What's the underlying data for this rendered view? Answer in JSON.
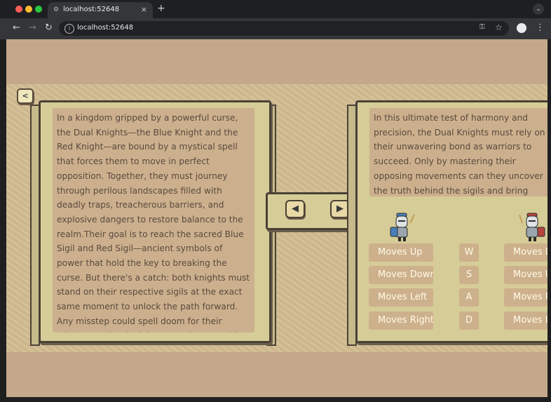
{
  "browser": {
    "tab_title": "localhost:52648",
    "address": "localhost:52648",
    "new_tab": "+",
    "close_tab": "×"
  },
  "game": {
    "back_glyph": "<",
    "prev_glyph": "◀",
    "next_glyph": "▶",
    "left_page_text": "In a kingdom gripped by a powerful curse, the Dual Knights—the Blue Knight and the Red Knight—are bound by a mystical spell that forces them to move in perfect opposition. Together, they must journey through perilous landscapes filled with deadly traps, treacherous barriers, and explosive dangers to restore balance to the realm.Their goal is to reach the sacred Blue Sigil and Red Sigil—ancient symbols of power that hold the key to breaking the curse. But there's a catch: both knights must stand on their respective sigils at the exact same moment to unlock the path forward. Any misstep could spell doom for their mission, and a clash between them would end their journey in a tragic battle.",
    "right_page_text": "In this ultimate test of harmony and precision, the Dual Knights must rely on their unwavering bond as warriors to succeed. Only by mastering their opposing movements can they uncover the truth behind the sigils and bring salvation to the world.",
    "controls": [
      {
        "blue": "Moves Up",
        "key": "W",
        "red": "Moves Down"
      },
      {
        "blue": "Moves Down",
        "key": "S",
        "red": "Moves Up"
      },
      {
        "blue": "Moves Left",
        "key": "A",
        "red": "Moves Right"
      },
      {
        "blue": "Moves Right",
        "key": "D",
        "red": "Moves Left"
      }
    ],
    "colors": {
      "page_bg": "#c4a88b",
      "book_paper": "#d6cc97",
      "text_panel": "#ccb08e",
      "blue_knight": "#4a7fb8",
      "red_knight": "#b8443f"
    },
    "icons": [
      "back-chevron-icon",
      "prev-arrow-icon",
      "next-arrow-icon",
      "blue-knight-icon",
      "red-knight-icon"
    ]
  }
}
